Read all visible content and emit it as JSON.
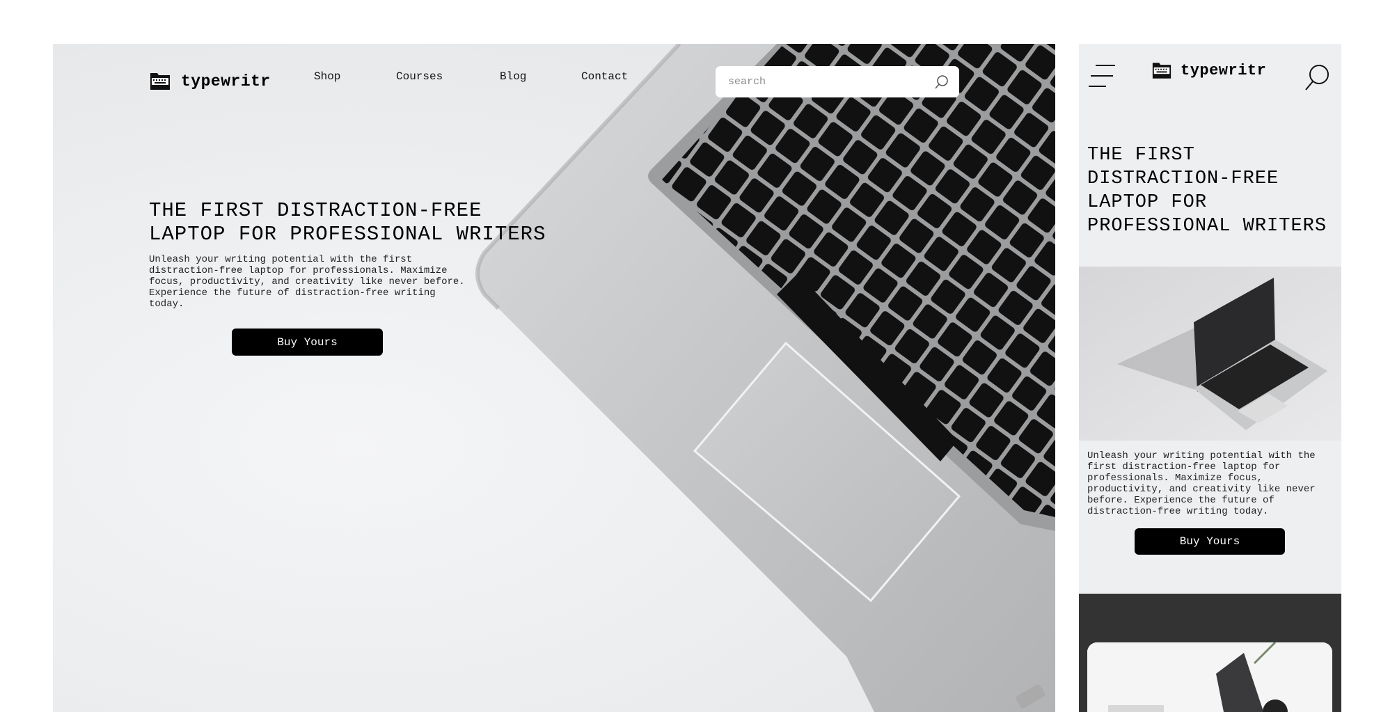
{
  "brand": {
    "name": "typewritr"
  },
  "desktop": {
    "nav": [
      "Shop",
      "Courses",
      "Blog",
      "Contact"
    ],
    "search": {
      "placeholder": "search"
    },
    "hero": {
      "title": "THE FIRST DISTRACTION-FREE LAPTOP FOR PROFESSIONAL WRITERS",
      "body": "Unleash your writing potential with the first distraction-free laptop for professionals. Maximize focus, productivity, and creativity like never before. Experience the future of distraction-free writing today.",
      "cta": "Buy Yours"
    }
  },
  "mobile": {
    "hero": {
      "title": "THE FIRST DISTRACTION-FREE LAPTOP FOR PROFESSIONAL WRITERS",
      "body": "Unleash your writing potential with the first distraction-free laptop for professionals. Maximize focus, productivity, and creativity like never before. Experience the future of distraction-free writing today.",
      "cta": "Buy Yours"
    }
  },
  "icons": {
    "logo": "typewriter-icon",
    "search": "search-icon",
    "menu": "hamburger-menu-icon"
  },
  "colors": {
    "accent": "#000000",
    "button_text": "#ffffff",
    "hero_bg": "#eceef0",
    "dark_section": "#333333"
  }
}
